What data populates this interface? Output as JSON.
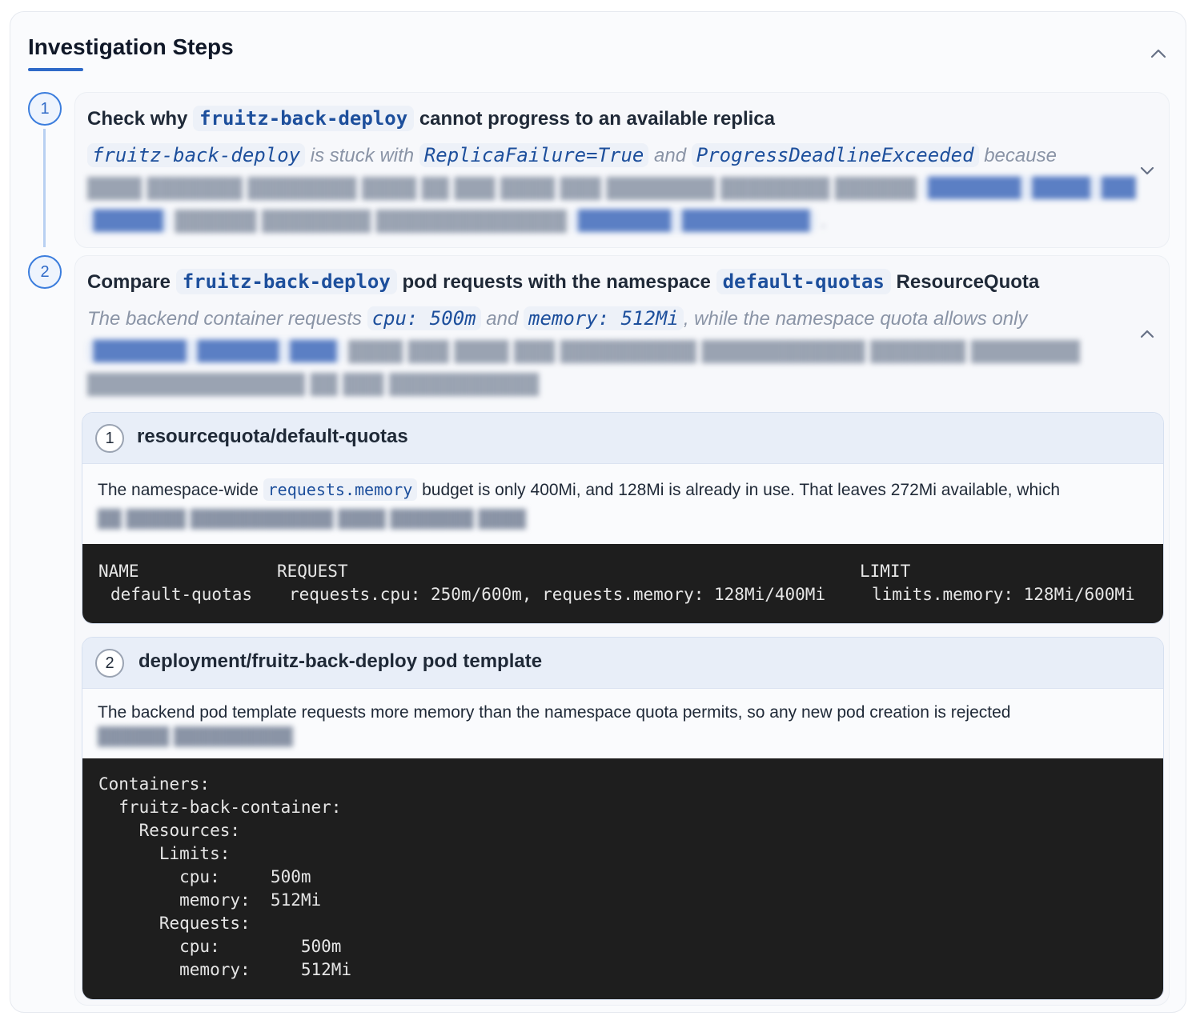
{
  "panel": {
    "title": "Investigation Steps"
  },
  "steps": [
    {
      "number": "1",
      "title_prefix": "Check why",
      "title_code": "fruitz-back-deploy",
      "title_suffix": "cannot progress to an available replica",
      "desc": {
        "code_a": "fruitz-back-deploy",
        "text_a": "is stuck with",
        "code_b": "ReplicaFailure=True",
        "text_b": "and",
        "code_c": "ProgressDeadlineExceeded",
        "text_c": "because"
      }
    },
    {
      "number": "2",
      "title_prefix": "Compare",
      "title_code": "fruitz-back-deploy",
      "title_middle": "pod requests with the namespace",
      "title_code2": "default-quotas",
      "title_suffix": "ResourceQuota",
      "desc": {
        "text_a": "The backend container requests",
        "code_a": "cpu: 500m",
        "text_b": "and",
        "code_b": "memory: 512Mi",
        "text_c": ", while the namespace quota allows only"
      },
      "evidence": [
        {
          "number": "1",
          "title": "resourcequota/default-quotas",
          "body_prefix": "The namespace-wide",
          "body_code": "requests.memory",
          "body_suffix": "budget is only 400Mi, and 128Mi is already in use. That leaves 272Mi available, which",
          "terminal": {
            "header_name": "NAME",
            "header_request": "REQUEST",
            "header_limit": "LIMIT",
            "row_name": "default-quotas",
            "row_request": "requests.cpu: 250m/600m, requests.memory: 128Mi/400Mi",
            "row_limit": "limits.memory: 128Mi/600Mi"
          }
        },
        {
          "number": "2",
          "title": "deployment/fruitz-back-deploy pod template",
          "body": "The backend pod template requests more memory than the namespace quota permits, so any new pod creation is rejected",
          "terminal_lines": [
            "Containers:",
            "  fruitz-back-container:",
            "    Resources:",
            "      Limits:",
            "        cpu:     500m",
            "        memory:  512Mi",
            "      Requests:",
            "        cpu:        500m",
            "        memory:     512Mi"
          ]
        }
      ]
    }
  ],
  "icons": {
    "collapse": "chevron-up-icon",
    "step1_toggle": "chevron-down-icon",
    "step2_toggle": "chevron-up-icon"
  },
  "colors": {
    "accent": "#2f6ac8",
    "code": "#1d4f9c",
    "terminal_bg": "#1e1e1e"
  }
}
